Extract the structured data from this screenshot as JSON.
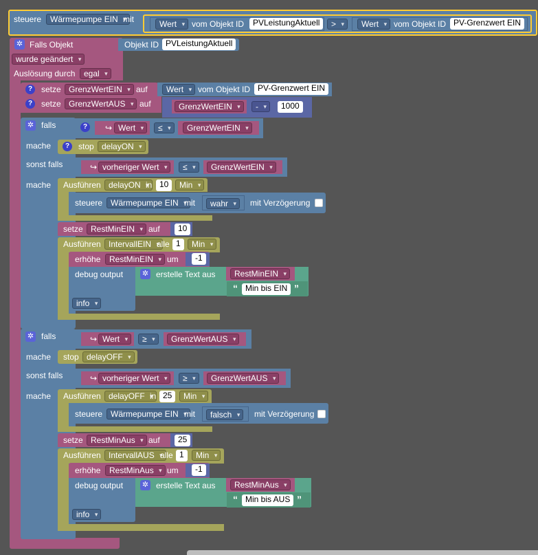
{
  "procedure": {
    "label": "steuere",
    "name": "Wärmepumpe EIN",
    "with": "mit",
    "left_attr": "Wert",
    "of_object": "vom Objekt ID",
    "left_id": "PVLeistungAktuell",
    "operator": ">",
    "right_attr": "Wert",
    "right_id": "PV-Grenzwert EIN"
  },
  "trigger": {
    "label": "Falls Objekt",
    "object_label": "Objekt ID",
    "object_id": "PVLeistungAktuell",
    "condition": "wurde geändert",
    "trigger_label": "Auslösung durch",
    "trigger_value": "egal"
  },
  "set_ein": {
    "label": "setze",
    "var": "GrenzWertEIN",
    "to": "auf",
    "attr": "Wert",
    "of_object": "vom Objekt ID",
    "id": "PV-Grenzwert EIN"
  },
  "set_aus": {
    "label": "setze",
    "var": "GrenzWertAUS",
    "to": "auf",
    "operand_var": "GrenzWertEIN",
    "operator": "-",
    "number": "1000"
  },
  "if1": {
    "if_label": "falls",
    "do_label": "mache",
    "elseif_label": "sonst falls",
    "cond_attr": "Wert",
    "cond_op": "≤",
    "cond_var": "GrenzWertEIN",
    "stop_label": "stop",
    "stop_var": "delayON",
    "elseif_attr": "vorheriger Wert",
    "elseif_op": "≤",
    "elseif_var": "GrenzWertEIN",
    "timeout_label": "Ausführen",
    "timeout_var": "delayON",
    "in_label": "in",
    "timeout_num": "10",
    "timeout_unit": "Min",
    "call_label": "steuere",
    "call_name": "Wärmepumpe EIN",
    "call_with": "mit",
    "call_value": "wahr",
    "delay_label": "mit Verzögerung",
    "set_label": "setze",
    "set_var": "RestMinEIN",
    "set_to": "auf",
    "set_num": "10",
    "interval_label": "Ausführen",
    "interval_var": "IntervallEIN",
    "every_label": "alle",
    "interval_num": "1",
    "interval_unit": "Min",
    "inc_label": "erhöhe",
    "inc_var": "RestMinEIN",
    "inc_by": "um",
    "inc_num": "-1",
    "debug_label": "debug output",
    "text_label": "erstelle Text aus",
    "text_var": "RestMinEIN",
    "text_str": "Min bis EIN",
    "level": "info"
  },
  "if2": {
    "if_label": "falls",
    "do_label": "mache",
    "elseif_label": "sonst falls",
    "cond_attr": "Wert",
    "cond_op": "≥",
    "cond_var": "GrenzWertAUS",
    "stop_label": "stop",
    "stop_var": "delayOFF",
    "elseif_attr": "vorheriger Wert",
    "elseif_op": "≥",
    "elseif_var": "GrenzWertAUS",
    "timeout_label": "Ausführen",
    "timeout_var": "delayOFF",
    "in_label": "in",
    "timeout_num": "25",
    "timeout_unit": "Min",
    "call_label": "steuere",
    "call_name": "Wärmepumpe EIN",
    "call_with": "mit",
    "call_value": "falsch",
    "delay_label": "mit Verzögerung",
    "set_label": "setze",
    "set_var": "RestMinAus",
    "set_to": "auf",
    "set_num": "25",
    "interval_label": "Ausführen",
    "interval_var": "IntervallAUS",
    "every_label": "alle",
    "interval_num": "1",
    "interval_unit": "Min",
    "inc_label": "erhöhe",
    "inc_var": "RestMinAus",
    "inc_by": "um",
    "inc_num": "-1",
    "debug_label": "debug output",
    "text_label": "erstelle Text aus",
    "text_var": "RestMinAus",
    "text_str": "Min bis AUS",
    "level": "info"
  },
  "icons": {
    "gear": "gear-icon",
    "help": "question-icon",
    "arrow": "return-arrow-icon"
  },
  "colors": {
    "workspace": "#555555",
    "event": "#a5577f",
    "logic": "#5b80a5",
    "timer": "#a5a55b",
    "text": "#5ba58c",
    "math": "#5b67a5",
    "selection": "#fc3"
  }
}
